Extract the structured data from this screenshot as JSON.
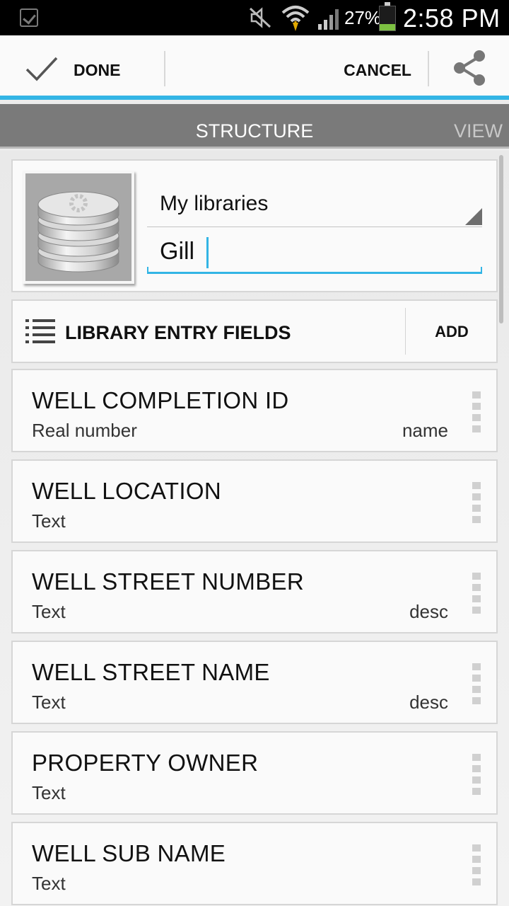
{
  "status_bar": {
    "battery_percent": "27%",
    "battery_level": 0.27,
    "time": "2:58 PM",
    "icons": [
      "notification-check-icon",
      "mute-icon",
      "wifi-icon",
      "signal-icon",
      "battery-icon"
    ]
  },
  "action_bar": {
    "done_label": "DONE",
    "cancel_label": "CANCEL",
    "accent_color": "#33b5e5"
  },
  "tabs": {
    "structure": "STRUCTURE",
    "view": "VIEW"
  },
  "header": {
    "library_select": "My libraries",
    "library_name": "Gill"
  },
  "section": {
    "title": "LIBRARY ENTRY FIELDS",
    "add_label": "ADD"
  },
  "fields": [
    {
      "name": "WELL COMPLETION ID",
      "type": "Real number",
      "role": "name"
    },
    {
      "name": "WELL LOCATION",
      "type": "Text",
      "role": ""
    },
    {
      "name": "WELL STREET NUMBER",
      "type": "Text",
      "role": "desc"
    },
    {
      "name": "WELL STREET NAME",
      "type": "Text",
      "role": "desc"
    },
    {
      "name": "PROPERTY OWNER",
      "type": "Text",
      "role": ""
    },
    {
      "name": "WELL SUB NAME",
      "type": "Text",
      "role": ""
    }
  ]
}
